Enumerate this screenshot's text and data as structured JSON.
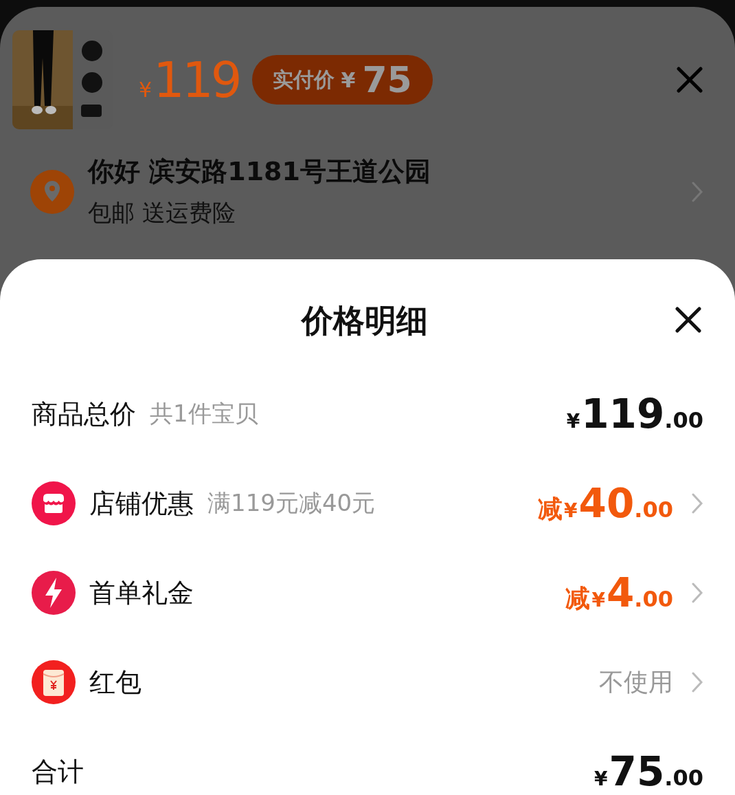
{
  "product": {
    "currency": "¥",
    "price": "119",
    "badge": {
      "label": "实付价",
      "currency": "¥",
      "amount": "75"
    }
  },
  "address": {
    "title": "你好 滨安路1181号王道公园",
    "subtitle": "包邮 送运费险"
  },
  "sheet": {
    "title": "价格明细",
    "rows": [
      {
        "kind": "total",
        "label": "商品总价",
        "note": "共1件宝贝",
        "prefix": "",
        "currency": "¥",
        "integer": "119",
        "decimals": ".00"
      },
      {
        "kind": "store",
        "label": "店铺优惠",
        "note": "满119元减40元",
        "prefix": "减",
        "currency": "¥",
        "integer": "40",
        "decimals": ".00"
      },
      {
        "kind": "gift",
        "label": "首单礼金",
        "note": "",
        "prefix": "减",
        "currency": "¥",
        "integer": "4",
        "decimals": ".00"
      },
      {
        "kind": "packet",
        "label": "红包",
        "value": "不使用"
      },
      {
        "kind": "total",
        "label": "合计",
        "note": "",
        "prefix": "",
        "currency": "¥",
        "integer": "75",
        "decimals": ".00"
      }
    ]
  }
}
